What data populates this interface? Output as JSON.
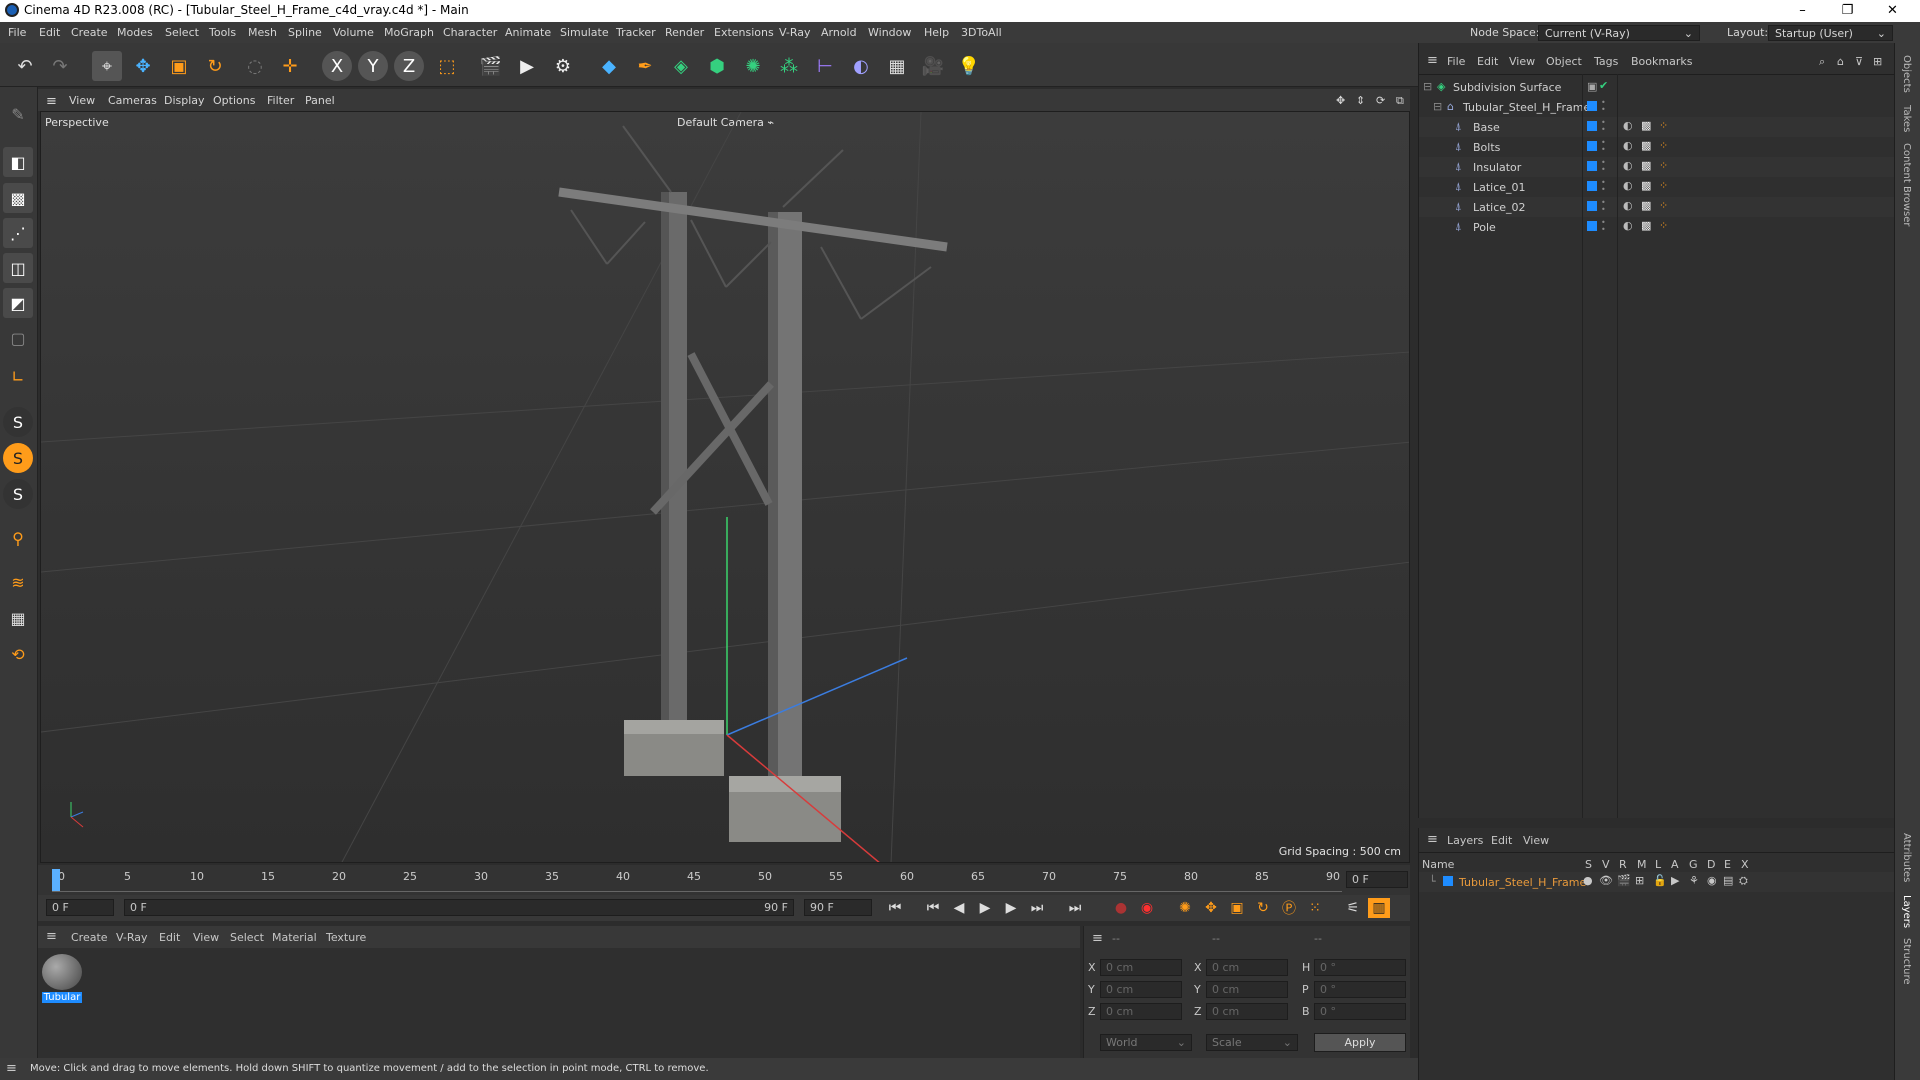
{
  "window": {
    "title": "Cinema 4D R23.008 (RC) - [Tubular_Steel_H_Frame_c4d_vray.c4d *] - Main",
    "controls": [
      "–",
      "❐",
      "✕"
    ]
  },
  "menubar": {
    "items": [
      "File",
      "Edit",
      "Create",
      "Modes",
      "Select",
      "Tools",
      "Mesh",
      "Spline",
      "Volume",
      "MoGraph",
      "Character",
      "Animate",
      "Simulate",
      "Tracker",
      "Render",
      "Extensions",
      "V-Ray",
      "Arnold",
      "Window",
      "Help",
      "3DToAll"
    ],
    "node_space_label": "Node Space:",
    "node_space_value": "Current (V-Ray)",
    "layout_label": "Layout:",
    "layout_value": "Startup (User)"
  },
  "viewport": {
    "menu": [
      "View",
      "Cameras",
      "Display",
      "Options",
      "Filter",
      "Panel"
    ],
    "label": "Perspective",
    "camera": "Default Camera",
    "grid_spacing": "Grid Spacing : 500 cm"
  },
  "timeline": {
    "ticks": [
      "0",
      "5",
      "10",
      "15",
      "20",
      "25",
      "30",
      "35",
      "40",
      "45",
      "50",
      "55",
      "60",
      "65",
      "70",
      "75",
      "80",
      "85",
      "90"
    ],
    "current_frame": "0 F"
  },
  "transport": {
    "start": "0 F",
    "range_start": "0 F",
    "range_end": "90 F",
    "end": "90 F"
  },
  "material_manager": {
    "menu": [
      "Create",
      "V-Ray",
      "Edit",
      "View",
      "Select",
      "Material",
      "Texture"
    ],
    "material_name": "Tubular"
  },
  "coordinates": {
    "headers": [
      "--",
      "--",
      "--"
    ],
    "rows": [
      {
        "a": "X",
        "av": "0 cm",
        "b": "X",
        "bv": "0 cm",
        "c": "H",
        "cv": "0 °"
      },
      {
        "a": "Y",
        "av": "0 cm",
        "b": "Y",
        "bv": "0 cm",
        "c": "P",
        "cv": "0 °"
      },
      {
        "a": "Z",
        "av": "0 cm",
        "b": "Z",
        "bv": "0 cm",
        "c": "B",
        "cv": "0 °"
      }
    ],
    "mode1": "World",
    "mode2": "Scale",
    "apply": "Apply"
  },
  "status": "Move: Click and drag to move elements. Hold down SHIFT to quantize movement / add to the selection in point mode, CTRL to remove.",
  "object_manager": {
    "menu": [
      "File",
      "Edit",
      "View",
      "Object",
      "Tags",
      "Bookmarks"
    ],
    "objects": [
      {
        "name": "Subdivision Surface"
      },
      {
        "name": "Tubular_Steel_H_Frame"
      },
      {
        "name": "Base"
      },
      {
        "name": "Bolts"
      },
      {
        "name": "Insulator"
      },
      {
        "name": "Latice_01"
      },
      {
        "name": "Latice_02"
      },
      {
        "name": "Pole"
      }
    ]
  },
  "layer_manager": {
    "menu": [
      "Layers",
      "Edit",
      "View"
    ],
    "name_header": "Name",
    "cols": [
      "S",
      "V",
      "R",
      "M",
      "L",
      "A",
      "G",
      "D",
      "E",
      "X"
    ],
    "layer": "Tubular_Steel_H_Frame"
  },
  "side_tabs": [
    "Objects",
    "Takes",
    "Content Browser",
    "Attributes",
    "Layers",
    "Structure"
  ],
  "colors": {
    "accent": "#1e8cff",
    "layer_text": "#e89a3c",
    "active": "#5ab0ff"
  }
}
